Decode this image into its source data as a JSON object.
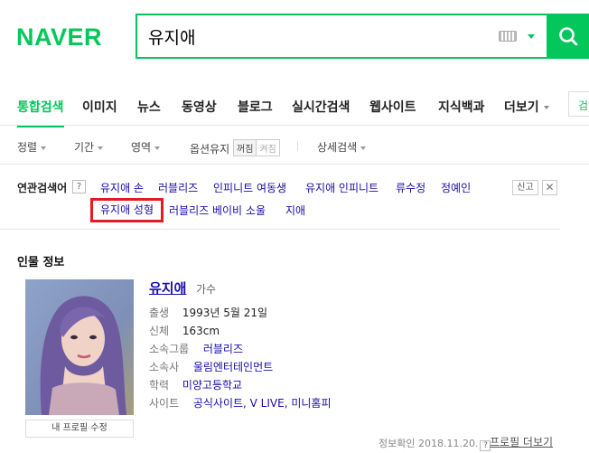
{
  "header": {
    "logo": "NAVER",
    "search_value": "유지애",
    "keyboard_icon": "keyboard-icon",
    "search_icon": "search-icon",
    "brand_color": "#03c75a"
  },
  "tabs": [
    {
      "label": "통합검색",
      "active": true
    },
    {
      "label": "이미지"
    },
    {
      "label": "뉴스"
    },
    {
      "label": "동영상"
    },
    {
      "label": "블로그"
    },
    {
      "label": "실시간검색"
    },
    {
      "label": "웹사이트"
    },
    {
      "label": "지식백과"
    },
    {
      "label": "더보기"
    }
  ],
  "tab_edge_label": "검",
  "options": {
    "sort": "정렬",
    "period": "기간",
    "area": "영역",
    "option_keep": "옵션유지",
    "toggle_on": "꺼짐",
    "toggle_off": "켜짐",
    "detail_search": "상세검색"
  },
  "related": {
    "title": "연관검색어",
    "help": "?",
    "links": [
      "유지애 손",
      "러블리즈",
      "인피니트 여동생",
      "유지애 인피니트",
      "류수정",
      "정예인",
      "유지애 성형",
      "러블리즈 베이비 소울",
      "지애"
    ],
    "report": "신고",
    "close": "✕",
    "highlight_color": "#e31b23"
  },
  "profile": {
    "section_title": "인물 정보",
    "name": "유지애",
    "job": "가수",
    "rows": {
      "birth_label": "출생",
      "birth_value": "1993년 5월 21일",
      "body_label": "신체",
      "body_value": "163cm",
      "group_label": "소속그룹",
      "group_value": "러블리즈",
      "agency_label": "소속사",
      "agency_value": "울림엔터테인먼트",
      "edu_label": "학력",
      "edu_value": "미양고등학교",
      "site_label": "사이트",
      "site_value": "공식사이트, V LIVE, 미니홈피"
    },
    "edit_button": "내 프로필 수정",
    "verify_text": "정보확인 2018.11.20.",
    "verify_help": "?",
    "more_link": "프로필 더보기"
  }
}
